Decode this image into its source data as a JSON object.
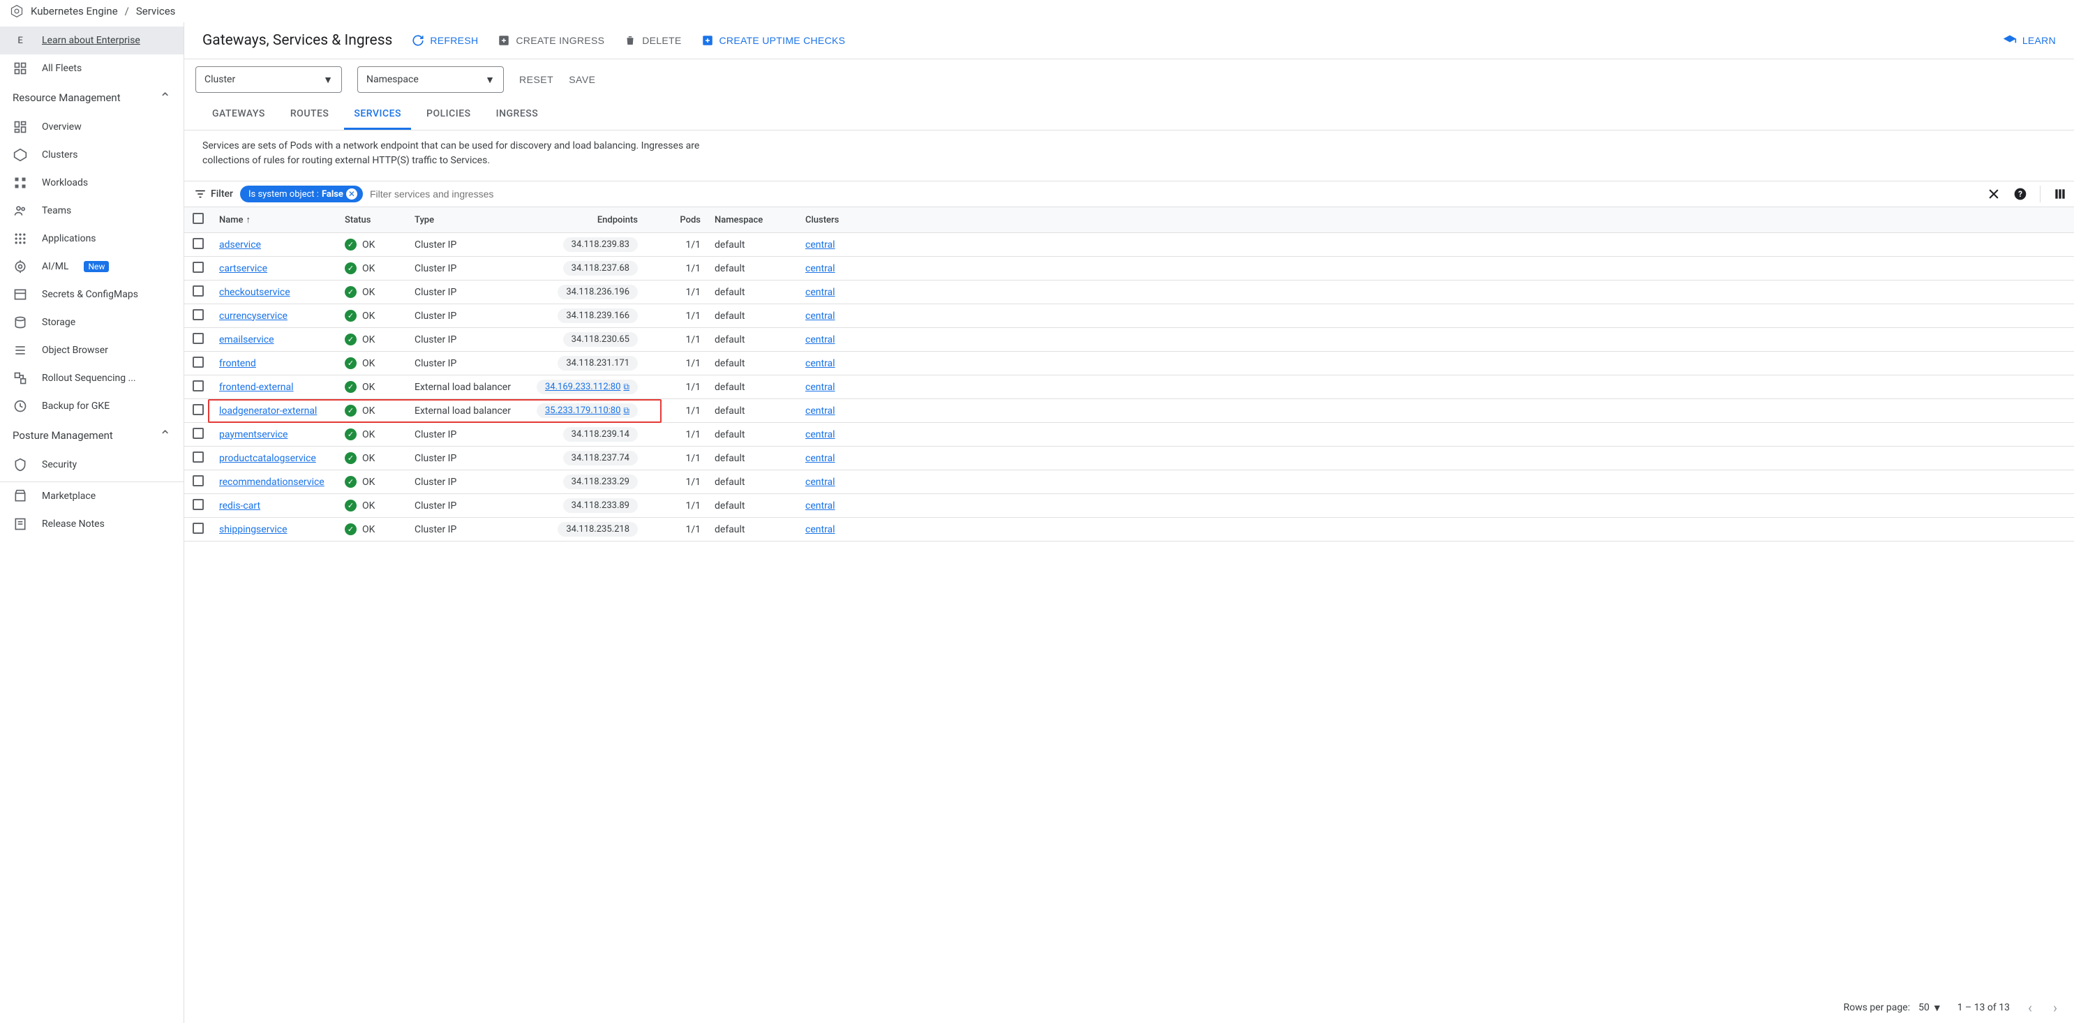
{
  "breadcrumb": {
    "product": "Kubernetes Engine",
    "page": "Services"
  },
  "sidebar": {
    "learnEnterprise": "Learn about Enterprise",
    "allFleets": "All Fleets",
    "sections": {
      "resource": {
        "title": "Resource Management",
        "items": [
          {
            "id": "overview",
            "label": "Overview"
          },
          {
            "id": "clusters",
            "label": "Clusters"
          },
          {
            "id": "workloads",
            "label": "Workloads"
          },
          {
            "id": "teams",
            "label": "Teams"
          },
          {
            "id": "applications",
            "label": "Applications"
          },
          {
            "id": "aiml",
            "label": "AI/ML",
            "badge": "New"
          },
          {
            "id": "secrets",
            "label": "Secrets & ConfigMaps"
          },
          {
            "id": "storage",
            "label": "Storage"
          },
          {
            "id": "objectbrowser",
            "label": "Object Browser"
          },
          {
            "id": "rollout",
            "label": "Rollout Sequencing ..."
          },
          {
            "id": "backup",
            "label": "Backup for GKE"
          }
        ]
      },
      "posture": {
        "title": "Posture Management",
        "items": [
          {
            "id": "security",
            "label": "Security"
          }
        ]
      }
    },
    "footer": {
      "marketplace": "Marketplace",
      "releaseNotes": "Release Notes"
    }
  },
  "header": {
    "title": "Gateways, Services & Ingress",
    "actions": {
      "refresh": "REFRESH",
      "createIngress": "CREATE INGRESS",
      "delete": "DELETE",
      "createUptime": "CREATE UPTIME CHECKS",
      "learn": "LEARN"
    }
  },
  "filterRow": {
    "clusterLabel": "Cluster",
    "namespaceLabel": "Namespace",
    "reset": "RESET",
    "save": "SAVE"
  },
  "tabs": [
    {
      "id": "gateways",
      "label": "GATEWAYS"
    },
    {
      "id": "routes",
      "label": "ROUTES"
    },
    {
      "id": "services",
      "label": "SERVICES",
      "active": true
    },
    {
      "id": "policies",
      "label": "POLICIES"
    },
    {
      "id": "ingress",
      "label": "INGRESS"
    }
  ],
  "description": "Services are sets of Pods with a network endpoint that can be used for discovery and load balancing. Ingresses are collections of rules for routing external HTTP(S) traffic to Services.",
  "tableFilter": {
    "label": "Filter",
    "chipPrefix": "Is system object : ",
    "chipValue": "False",
    "placeholder": "Filter services and ingresses"
  },
  "columns": {
    "name": "Name",
    "status": "Status",
    "type": "Type",
    "endpoints": "Endpoints",
    "pods": "Pods",
    "namespace": "Namespace",
    "clusters": "Clusters"
  },
  "rows": [
    {
      "name": "adservice",
      "status": "OK",
      "type": "Cluster IP",
      "endpoint": "34.118.239.83",
      "epLink": false,
      "pods": "1/1",
      "ns": "default",
      "cluster": "central"
    },
    {
      "name": "cartservice",
      "status": "OK",
      "type": "Cluster IP",
      "endpoint": "34.118.237.68",
      "epLink": false,
      "pods": "1/1",
      "ns": "default",
      "cluster": "central"
    },
    {
      "name": "checkoutservice",
      "status": "OK",
      "type": "Cluster IP",
      "endpoint": "34.118.236.196",
      "epLink": false,
      "pods": "1/1",
      "ns": "default",
      "cluster": "central"
    },
    {
      "name": "currencyservice",
      "status": "OK",
      "type": "Cluster IP",
      "endpoint": "34.118.239.166",
      "epLink": false,
      "pods": "1/1",
      "ns": "default",
      "cluster": "central"
    },
    {
      "name": "emailservice",
      "status": "OK",
      "type": "Cluster IP",
      "endpoint": "34.118.230.65",
      "epLink": false,
      "pods": "1/1",
      "ns": "default",
      "cluster": "central"
    },
    {
      "name": "frontend",
      "status": "OK",
      "type": "Cluster IP",
      "endpoint": "34.118.231.171",
      "epLink": false,
      "pods": "1/1",
      "ns": "default",
      "cluster": "central"
    },
    {
      "name": "frontend-external",
      "status": "OK",
      "type": "External load balancer",
      "endpoint": "34.169.233.112:80",
      "epLink": true,
      "pods": "1/1",
      "ns": "default",
      "cluster": "central"
    },
    {
      "name": "loadgenerator-external",
      "status": "OK",
      "type": "External load balancer",
      "endpoint": "35.233.179.110:80",
      "epLink": true,
      "pods": "1/1",
      "ns": "default",
      "cluster": "central",
      "highlighted": true
    },
    {
      "name": "paymentservice",
      "status": "OK",
      "type": "Cluster IP",
      "endpoint": "34.118.239.14",
      "epLink": false,
      "pods": "1/1",
      "ns": "default",
      "cluster": "central"
    },
    {
      "name": "productcatalogservice",
      "status": "OK",
      "type": "Cluster IP",
      "endpoint": "34.118.237.74",
      "epLink": false,
      "pods": "1/1",
      "ns": "default",
      "cluster": "central"
    },
    {
      "name": "recommendationservice",
      "status": "OK",
      "type": "Cluster IP",
      "endpoint": "34.118.233.29",
      "epLink": false,
      "pods": "1/1",
      "ns": "default",
      "cluster": "central"
    },
    {
      "name": "redis-cart",
      "status": "OK",
      "type": "Cluster IP",
      "endpoint": "34.118.233.89",
      "epLink": false,
      "pods": "1/1",
      "ns": "default",
      "cluster": "central"
    },
    {
      "name": "shippingservice",
      "status": "OK",
      "type": "Cluster IP",
      "endpoint": "34.118.235.218",
      "epLink": false,
      "pods": "1/1",
      "ns": "default",
      "cluster": "central"
    }
  ],
  "footer": {
    "rowsLabel": "Rows per page:",
    "rowsValue": "50",
    "rangeText": "1 – 13 of 13"
  }
}
